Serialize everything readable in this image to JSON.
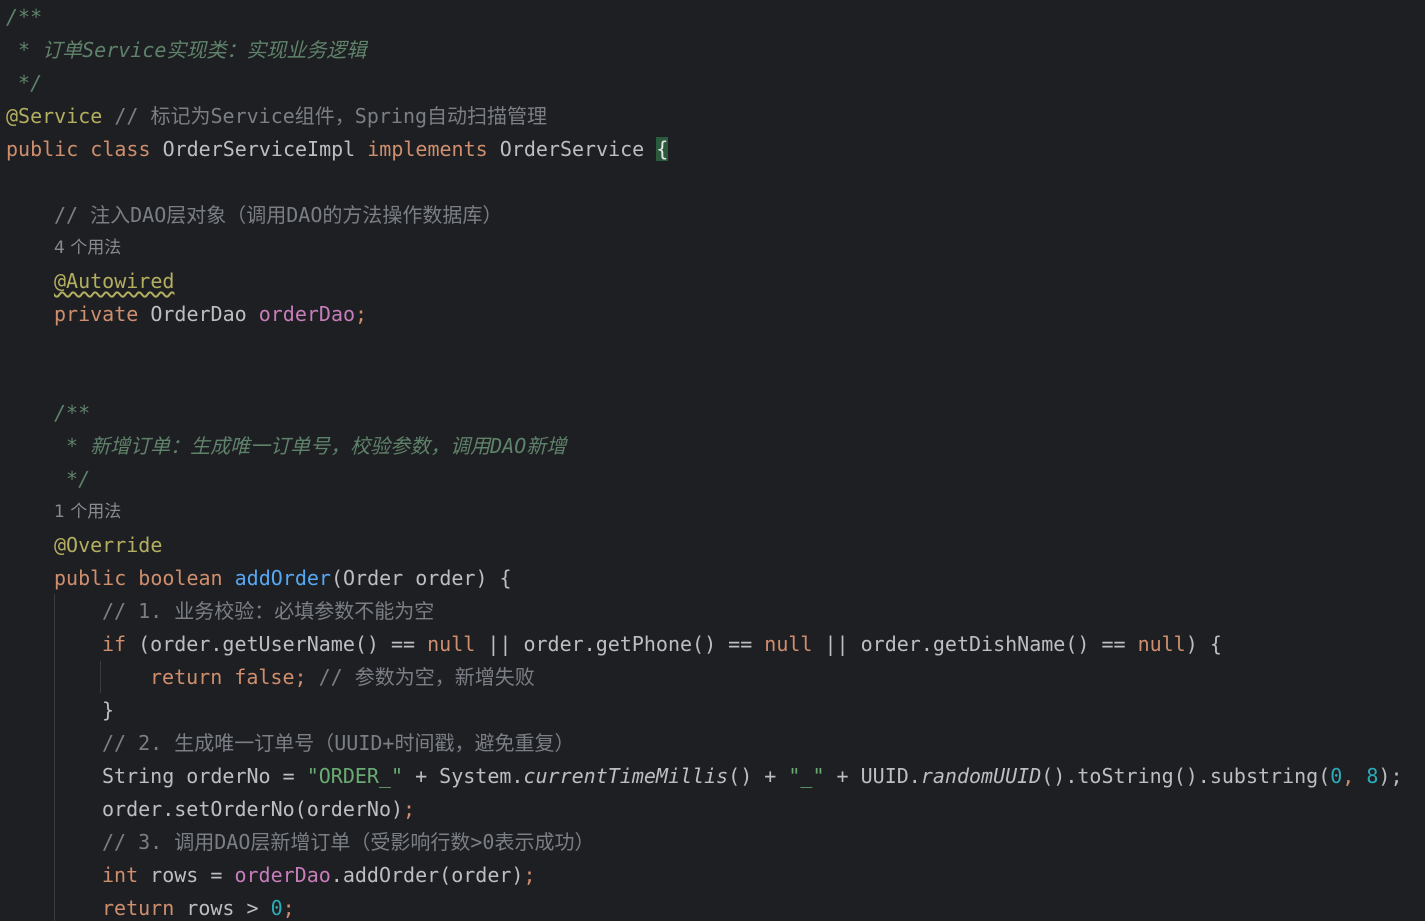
{
  "editor": {
    "class_doc": {
      "open": "/**",
      "line": " * 订单Service实现类：实现业务逻辑",
      "close": " */"
    },
    "service_annotation": "@Service",
    "service_comment": "// 标记为Service组件，Spring自动扫描管理",
    "class_decl": {
      "public": "public",
      "class": "class",
      "name": "OrderServiceImpl",
      "implements": "implements",
      "interface": "OrderService",
      "brace": "{"
    },
    "inject_comment": "// 注入DAO层对象（调用DAO的方法操作数据库）",
    "usages_1": "4 个用法",
    "autowired": "@Autowired",
    "field_decl": {
      "private": "private",
      "type": "OrderDao",
      "name": "orderDao",
      "semi": ";"
    },
    "method_doc": {
      "open": "/**",
      "line": " * 新增订单：生成唯一订单号，校验参数，调用DAO新增",
      "close": " */"
    },
    "usages_2": "1 个用法",
    "override": "@Override",
    "method_decl": {
      "public": "public",
      "boolean": "boolean",
      "name": "addOrder",
      "params": "(Order order) {"
    },
    "comment_1": "// 1. 业务校验：必填参数不能为空",
    "if_line": {
      "if": "if",
      "open": " (order.getUserName() == ",
      "null1": "null",
      "or1": " || order.getPhone() == ",
      "null2": "null",
      "or2": " || order.getDishName() == ",
      "null3": "null",
      "close": ") {"
    },
    "return_false": {
      "return": "return",
      "false": "false",
      "semi": ";",
      "comment": "// 参数为空，新增失败"
    },
    "close_brace": "}",
    "comment_2": "// 2. 生成唯一订单号（UUID+时间戳，避免重复）",
    "order_no_line": {
      "decl": "String orderNo = ",
      "str1": "\"ORDER_\"",
      "plus1": " + System.",
      "ctm": "currentTimeMillis",
      "plus2": "() + ",
      "str2": "\"_\"",
      "plus3": " + UUID.",
      "ruuid": "randomUUID",
      "tail": "().toString().substring(",
      "n0": "0",
      "comma": ", ",
      "n8": "8",
      "end": ");"
    },
    "set_order_no": {
      "code": "order.setOrderNo(orderNo)",
      "semi": ";"
    },
    "comment_3": "// 3. 调用DAO层新增订单（受影响行数>0表示成功）",
    "rows_line": {
      "int": "int",
      "mid": " rows = ",
      "field": "orderDao",
      "call": ".addOrder(order)",
      "semi": ";"
    },
    "return_rows": {
      "return": "return",
      "mid": " rows > ",
      "zero": "0",
      "semi": ";"
    }
  },
  "colors": {
    "background": "#1e1f22",
    "keyword": "#cf8e6d",
    "annotation": "#b3ae60",
    "field": "#c77dbb",
    "method": "#56a8f5",
    "string": "#6aab73",
    "number": "#2aacb8",
    "doc_comment": "#5f826b",
    "line_comment": "#7a7e85"
  }
}
